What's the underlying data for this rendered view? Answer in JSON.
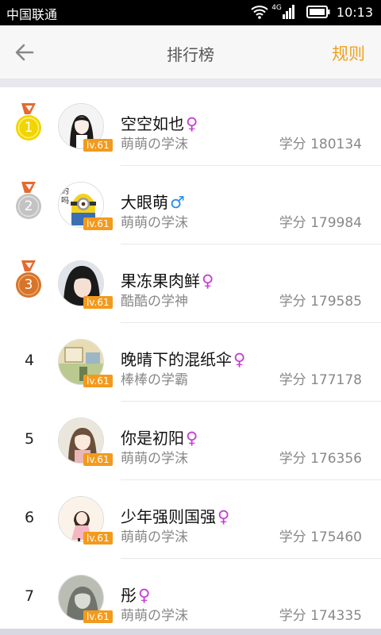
{
  "status_bar": {
    "carrier": "中国联通",
    "network": "4G",
    "time": "10:13"
  },
  "header": {
    "title": "排行榜",
    "rules_label": "规则",
    "back_icon": "arrow-left-icon"
  },
  "colors": {
    "accent": "#f0a020",
    "level_badge": "#f39a1d",
    "female": "#c43fd3",
    "male": "#2a8df0",
    "gold": "#f2d500",
    "silver": "#c3c3c3",
    "bronze": "#d8742a"
  },
  "ranking": [
    {
      "rank": "1",
      "medal": "gold",
      "name": "空空如也",
      "gender": "♀",
      "gender_type": "female",
      "level": "lv.61",
      "title": "萌萌の学沫",
      "score": "学分 180134"
    },
    {
      "rank": "2",
      "medal": "silver",
      "name": "大眼萌",
      "gender": "♂",
      "gender_type": "male",
      "level": "lv.61",
      "title": "萌萌の学沫",
      "score": "学分 179984"
    },
    {
      "rank": "3",
      "medal": "bronze",
      "name": "果冻果肉鲜",
      "gender": "♀",
      "gender_type": "female",
      "level": "lv.61",
      "title": "酷酷の学神",
      "score": "学分 179585"
    },
    {
      "rank": "4",
      "medal": "",
      "name": "晚晴下的混纸伞",
      "gender": "♀",
      "gender_type": "female",
      "level": "lv.61",
      "title": "棒棒の学霸",
      "score": "学分 177178"
    },
    {
      "rank": "5",
      "medal": "",
      "name": "你是初阳",
      "gender": "♀",
      "gender_type": "female",
      "level": "lv.61",
      "title": "萌萌の学沫",
      "score": "学分 176356"
    },
    {
      "rank": "6",
      "medal": "",
      "name": "少年强则国强",
      "gender": "♀",
      "gender_type": "female",
      "level": "lv.61",
      "title": "萌萌の学沫",
      "score": "学分 175460"
    },
    {
      "rank": "7",
      "medal": "",
      "name": "彤",
      "gender": "♀",
      "gender_type": "female",
      "level": "lv.61",
      "title": "萌萌の学沫",
      "score": "学分 174335"
    }
  ]
}
